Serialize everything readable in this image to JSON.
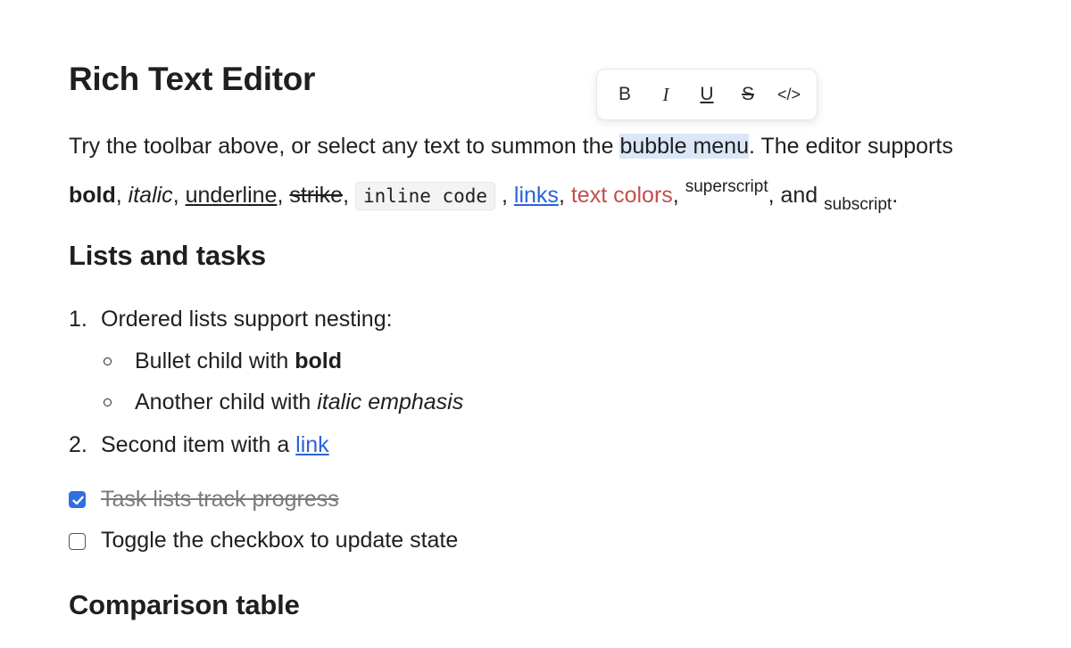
{
  "title": "Rich Text Editor",
  "toolbar": {
    "bold": "B",
    "italic": "I",
    "underline": "U",
    "strike": "S",
    "code": "</>"
  },
  "intro": {
    "t1": "Try the toolbar above, or select any text to summon the ",
    "selected": "bubble menu",
    "t2": ". The editor supports",
    "bold": "bold",
    "c1": ", ",
    "italic": "italic",
    "c2": ", ",
    "underline": "underline",
    "c3": ", ",
    "strike": "strike",
    "c4": ", ",
    "code": "inline code",
    "c5": " , ",
    "links": "links",
    "c6": ", ",
    "colors": "text colors",
    "c7": ", ",
    "superscript": "superscript",
    "c8": ", and ",
    "subscript": "subscript",
    "c9": "."
  },
  "lists_heading": "Lists and tasks",
  "ordered": [
    {
      "num": "1.",
      "text": "Ordered lists support nesting:"
    },
    {
      "num": "2.",
      "text": "Second item with a ",
      "link": "link"
    }
  ],
  "nested": [
    {
      "text": "Bullet child with ",
      "em": "bold"
    },
    {
      "text": "Another child with ",
      "em": "italic emphasis"
    }
  ],
  "tasks": [
    {
      "text": "Task lists track progress",
      "checked": true
    },
    {
      "text": "Toggle the checkbox to update state",
      "checked": false
    }
  ],
  "colors": {
    "accent": "#2f6fe0",
    "link": "#2a64d6",
    "red": "#c0504d",
    "selection": "#dbe6f7"
  },
  "table_heading": "Comparison table"
}
